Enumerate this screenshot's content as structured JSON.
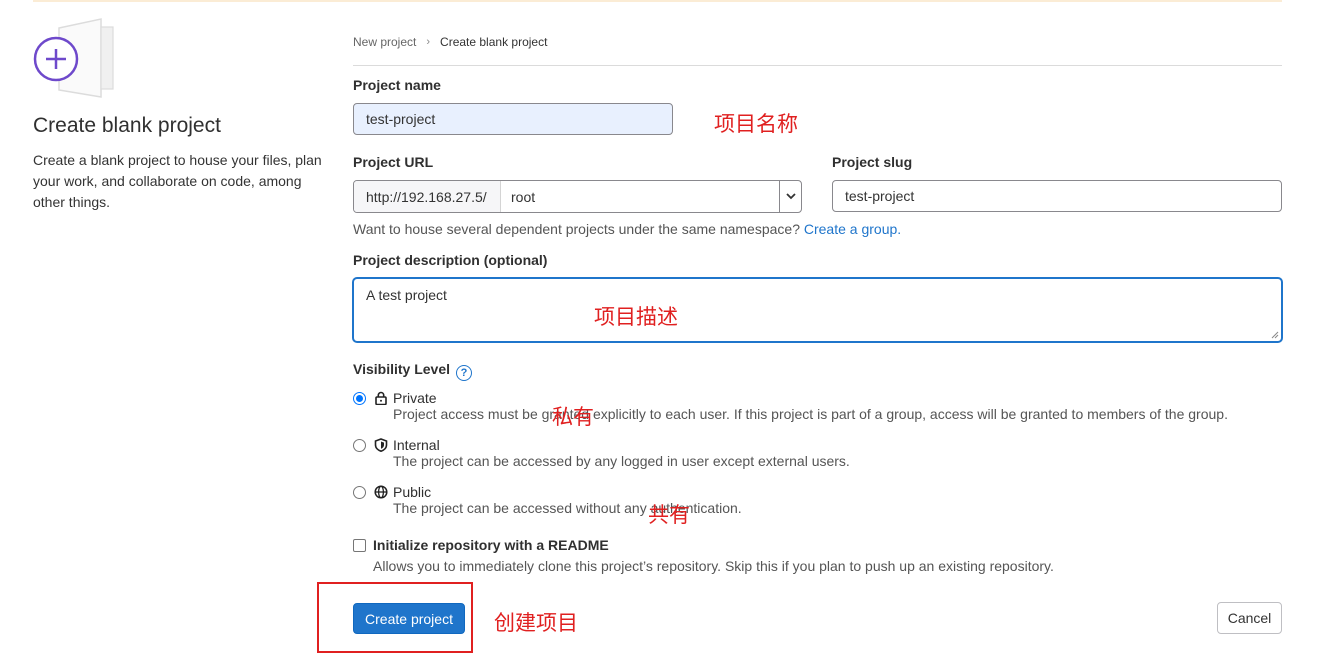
{
  "left": {
    "title": "Create blank project",
    "description": "Create a blank project to house your files, plan your work, and collaborate on code, among other things."
  },
  "breadcrumb": {
    "parent": "New project",
    "separator": "›",
    "current": "Create blank project"
  },
  "form": {
    "project_name_label": "Project name",
    "project_name_value": "test-project",
    "project_url_label": "Project URL",
    "project_url_prefix": "http://192.168.27.5/",
    "project_url_namespace": "root",
    "project_slug_label": "Project slug",
    "project_slug_value": "test-project",
    "namespace_help": "Want to house several dependent projects under the same namespace?",
    "namespace_link": "Create a group.",
    "description_label": "Project description (optional)",
    "description_value": "A test project",
    "visibility_label": "Visibility Level",
    "visibility_options": [
      {
        "label": "Private",
        "desc": "Project access must be granted explicitly to each user. If this project is part of a group, access will be granted to members of the group.",
        "checked": true,
        "icon": "lock-icon"
      },
      {
        "label": "Internal",
        "desc": "The project can be accessed by any logged in user except external users.",
        "checked": false,
        "icon": "shield-icon"
      },
      {
        "label": "Public",
        "desc": "The project can be accessed without any authentication.",
        "checked": false,
        "icon": "globe-icon"
      }
    ],
    "readme_label": "Initialize repository with a README",
    "readme_desc": "Allows you to immediately clone this project’s repository. Skip this if you plan to push up an existing repository.",
    "readme_checked": false
  },
  "buttons": {
    "create": "Create project",
    "cancel": "Cancel"
  },
  "annotations": {
    "project_name": "项目名称",
    "description": "项目描述",
    "private": "私有",
    "public": "共有",
    "create": "创建项目"
  },
  "colors": {
    "accent": "#1f75cb",
    "annotation": "#e02020",
    "illustration": "#6e49cb"
  }
}
